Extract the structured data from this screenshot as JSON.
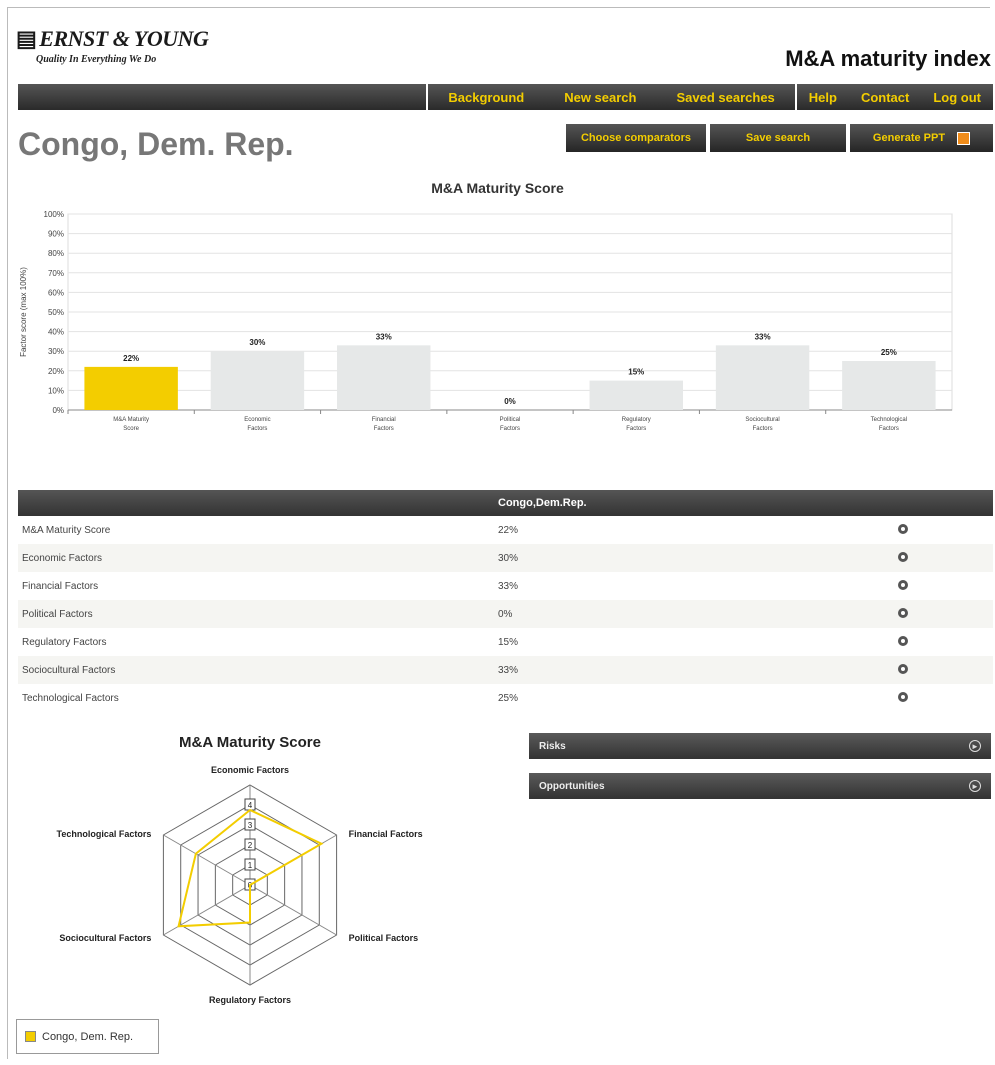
{
  "header": {
    "logo_text": "ERNST & YOUNG",
    "logo_tagline": "Quality In Everything We Do",
    "app_title": "M&A maturity index"
  },
  "nav": {
    "main": [
      "Background",
      "New search",
      "Saved searches"
    ],
    "secondary": [
      "Help",
      "Contact",
      "Log out"
    ]
  },
  "page": {
    "country": "Congo, Dem. Rep."
  },
  "actions": {
    "choose": "Choose comparators",
    "save": "Save search",
    "ppt": "Generate PPT"
  },
  "colors": {
    "accent": "#f3cd00",
    "bar_other": "#e6e8e8",
    "nav_bg": "#333333"
  },
  "chart_data": {
    "type": "bar",
    "title": "M&A Maturity Score",
    "ylabel": "Factor score (max 100%)",
    "ylim": [
      0,
      100
    ],
    "yticks": [
      "0%",
      "10%",
      "20%",
      "30%",
      "40%",
      "50%",
      "60%",
      "70%",
      "80%",
      "90%",
      "100%"
    ],
    "categories": [
      [
        "M&A Maturity",
        "Score"
      ],
      [
        "Economic",
        "Factors"
      ],
      [
        "Financial",
        "Factors"
      ],
      [
        "Political",
        "Factors"
      ],
      [
        "Regulatory",
        "Factors"
      ],
      [
        "Sociocultural",
        "Factors"
      ],
      [
        "Technological",
        "Factors"
      ]
    ],
    "values": [
      22,
      30,
      33,
      0,
      15,
      33,
      25
    ],
    "value_labels": [
      "22%",
      "30%",
      "33%",
      "0%",
      "15%",
      "33%",
      "25%"
    ],
    "highlight_index": 0,
    "grid": true
  },
  "table": {
    "header": "Congo,Dem.Rep.",
    "rows": [
      {
        "label": "M&A Maturity Score",
        "value": "22%"
      },
      {
        "label": "Economic Factors",
        "value": "30%"
      },
      {
        "label": "Financial Factors",
        "value": "33%"
      },
      {
        "label": "Political Factors",
        "value": "0%"
      },
      {
        "label": "Regulatory Factors",
        "value": "15%"
      },
      {
        "label": "Sociocultural Factors",
        "value": "33%"
      },
      {
        "label": "Technological Factors",
        "value": "25%"
      }
    ]
  },
  "radar": {
    "title": "M&A Maturity Score",
    "axes": [
      "Economic Factors",
      "Financial Factors",
      "Political Factors",
      "Regulatory Factors",
      "Sociocultural Factors",
      "Technological Factors"
    ],
    "values": [
      30,
      33,
      0,
      15,
      33,
      25
    ],
    "max": 40,
    "ring_labels": [
      "0",
      "1",
      "2",
      "3",
      "4"
    ]
  },
  "panels": {
    "risks": "Risks",
    "opportunities": "Opportunities"
  },
  "legend": {
    "label": "Congo, Dem. Rep."
  }
}
